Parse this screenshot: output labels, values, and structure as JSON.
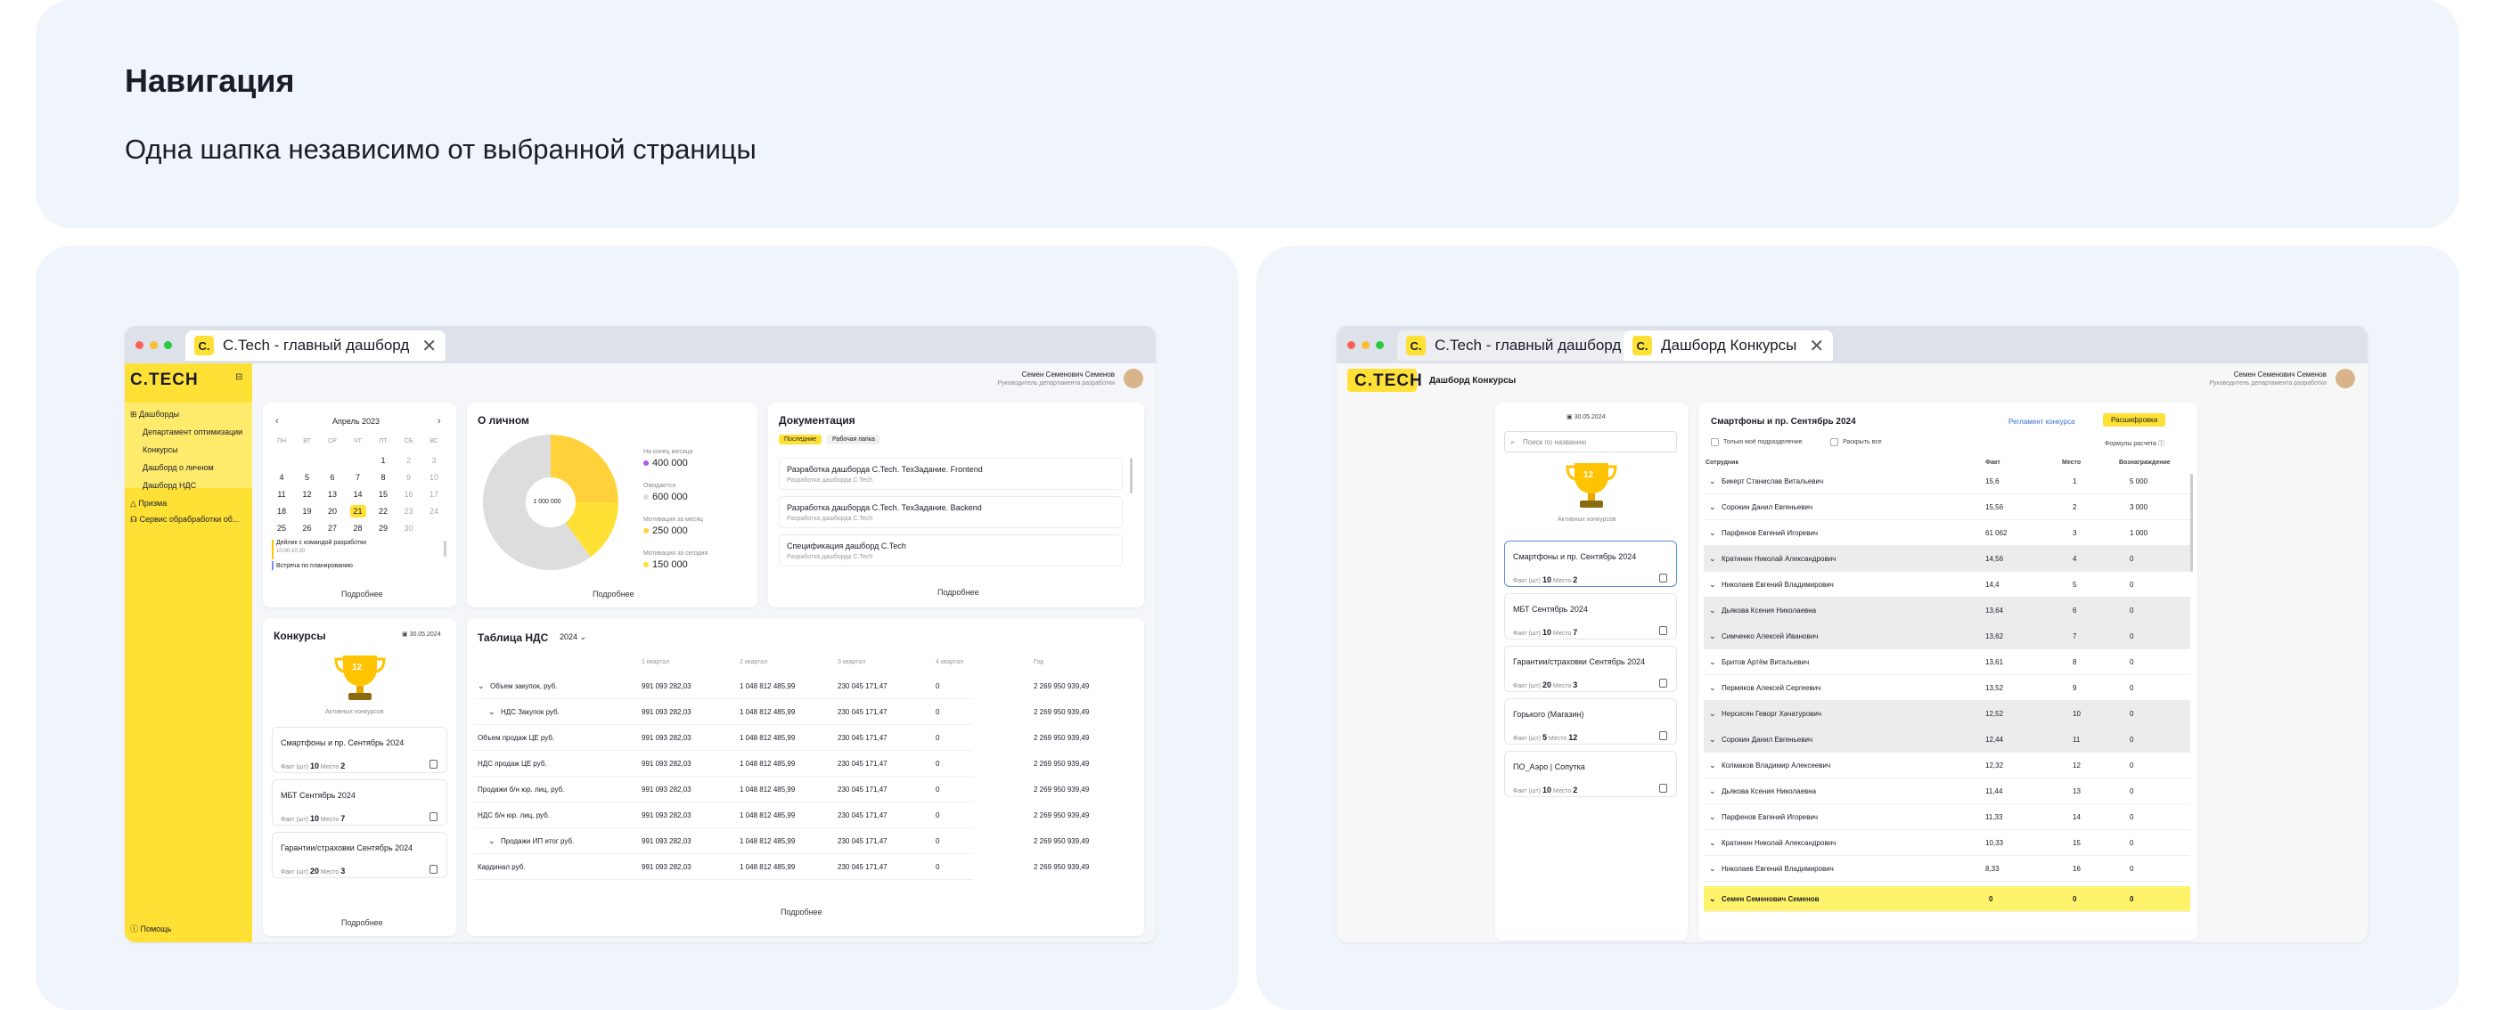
{
  "header": {
    "title": "Навигация",
    "subtitle": "Одна шапка независимо от выбранной страницы"
  },
  "left": {
    "tab": "C.Tech - главный дашборд",
    "logo": "C.TECH",
    "user": {
      "name": "Семен Семенович Семенов",
      "role": "Руководитель департамента разработки"
    },
    "sidebar": {
      "dashboards": "Дашборды",
      "items": [
        "Департамент оптимизации",
        "Конкурсы",
        "Дашборд о личном",
        "Дашборд НДС"
      ],
      "prizma": "Призма",
      "service": "Сервис обрабработки об...",
      "help": "Помощь"
    },
    "calendar": {
      "month": "Апрель 2023",
      "days": [
        "ПН",
        "ВТ",
        "СР",
        "ЧТ",
        "ПТ",
        "СБ",
        "ВС"
      ],
      "weeks": [
        [
          "",
          "",
          "",
          "",
          "1",
          "2",
          "3"
        ],
        [
          "4",
          "5",
          "6",
          "7",
          "8",
          "9",
          "10"
        ],
        [
          "11",
          "12",
          "13",
          "14",
          "15",
          "16",
          "17"
        ],
        [
          "18",
          "19",
          "20",
          "21",
          "22",
          "23",
          "24"
        ],
        [
          "25",
          "26",
          "27",
          "28",
          "29",
          "30",
          ""
        ]
      ],
      "today": "21",
      "events": [
        {
          "title": "Дейлик с командой разработки",
          "time": "10:00-10:30"
        },
        {
          "title": "Встреча по планированию",
          "time": ""
        }
      ],
      "more": "Подробнее"
    },
    "personal": {
      "title": "О личном",
      "center": "1 000 000",
      "stats": [
        {
          "label": "На конец месяца",
          "value": "400 000",
          "color": "#a65cf0"
        },
        {
          "label": "Ожидается",
          "value": "600 000",
          "color": "#dddddd"
        },
        {
          "label": "Мотивация за месяц",
          "value": "250 000",
          "color": "#ffd23c"
        },
        {
          "label": "Мотивация за сегодня",
          "value": "150 000",
          "color": "#ffe135"
        }
      ],
      "more": "Подробнее"
    },
    "docs": {
      "title": "Документация",
      "tabs": [
        "Последние",
        "Рабочая папка"
      ],
      "items": [
        {
          "title": "Разработка дашборда C.Tech. ТехЗадание. Frontend",
          "sub": "Разработка дашборда C.Tech"
        },
        {
          "title": "Разработка дашборда C.Tech. ТехЗадание. Backend",
          "sub": "Разработка дашборда C.Tech"
        },
        {
          "title": "Спецификация дашборд C.Tech",
          "sub": "Разработка дашборда C.Tech"
        }
      ],
      "more": "Подробнее"
    },
    "contests": {
      "title": "Конкурсы",
      "date": "30.05.2024",
      "count": "12",
      "count_label": "Активных конкурсов",
      "fact_label": "Факт (шт)",
      "place_label": "Место",
      "items": [
        {
          "name": "Смартфоны и пр. Сентябрь 2024",
          "fact": "10",
          "place": "2"
        },
        {
          "name": "МБТ Сентябрь 2024",
          "fact": "10",
          "place": "7"
        },
        {
          "name": "Гарантии/страховки Сентябрь 2024",
          "fact": "20",
          "place": "3"
        }
      ],
      "more": "Подробнее"
    },
    "vat": {
      "title": "Таблица НДС",
      "year": "2024",
      "cols": [
        "1 квартал",
        "2 квартал",
        "3 квартал",
        "4 квартал",
        "Год"
      ],
      "rows": [
        {
          "label": "Объем закупок, руб.",
          "chev": true,
          "indent": false,
          "v": [
            "991 093 282,03",
            "1 048 812 485,99",
            "230 045 171,47",
            "0",
            "2 269 950 939,49"
          ]
        },
        {
          "label": "НДС Закупок руб.",
          "chev": true,
          "indent": true,
          "v": [
            "991 093 282,03",
            "1 048 812 485,99",
            "230 045 171,47",
            "0",
            "2 269 950 939,49"
          ]
        },
        {
          "label": "Объем продаж ЦЕ руб.",
          "chev": false,
          "indent": false,
          "v": [
            "991 093 282,03",
            "1 048 812 485,99",
            "230 045 171,47",
            "0",
            "2 269 950 939,49"
          ]
        },
        {
          "label": "НДС продаж ЦЕ руб.",
          "chev": false,
          "indent": false,
          "v": [
            "991 093 282,03",
            "1 048 812 485,99",
            "230 045 171,47",
            "0",
            "2 269 950 939,49"
          ]
        },
        {
          "label": "Продажи б/н юр. лиц, руб.",
          "chev": false,
          "indent": false,
          "v": [
            "991 093 282,03",
            "1 048 812 485,99",
            "230 045 171,47",
            "0",
            "2 269 950 939,49"
          ]
        },
        {
          "label": "НДС б/н юр. лиц, руб.",
          "chev": false,
          "indent": false,
          "v": [
            "991 093 282,03",
            "1 048 812 485,99",
            "230 045 171,47",
            "0",
            "2 269 950 939,49"
          ]
        },
        {
          "label": "Продажи ИП итог руб.",
          "chev": true,
          "indent": true,
          "v": [
            "991 093 282,03",
            "1 048 812 485,99",
            "230 045 171,47",
            "0",
            "2 269 950 939,49"
          ]
        },
        {
          "label": "Кардинал руб.",
          "chev": false,
          "indent": false,
          "v": [
            "991 093 282,03",
            "1 048 812 485,99",
            "230 045 171,47",
            "0",
            "2 269 950 939,49"
          ]
        }
      ],
      "more": "Подробнее"
    }
  },
  "right": {
    "tabs": [
      "C.Tech - главный дашборд",
      "Дашборд Конкурсы"
    ],
    "logo": "C.TECH",
    "page_title": "Дашборд Конкурсы",
    "user": {
      "name": "Семен Семенович Семенов",
      "role": "Руководитель департамента разработки"
    },
    "date": "30.05.2024",
    "search_placeholder": "Поиск по названию",
    "count": "12",
    "count_label": "Активных конкурсов",
    "fact_label": "Факт (шт)",
    "place_label": "Место",
    "list": [
      {
        "name": "Смартфоны и пр. Сентябрь 2024",
        "fact": "10",
        "place": "2"
      },
      {
        "name": "МБТ Сентябрь 2024",
        "fact": "10",
        "place": "7"
      },
      {
        "name": "Гарантии/страховки Сентябрь 2024",
        "fact": "20",
        "place": "3"
      },
      {
        "name": "Горького (Магазин)",
        "fact": "5",
        "place": "12"
      },
      {
        "name": "ПО_Аэро | Сопутка",
        "fact": "10",
        "place": "2"
      }
    ],
    "detail": {
      "title": "Смартфоны и пр. Сентябрь 2024",
      "rules": "Регламент конкурса",
      "breakdown": "Расшифровка",
      "only_mine": "Только моё подразделение",
      "expand_all": "Раскрыть все",
      "formulas": "Формулы расчета",
      "cols": [
        "Сотрудник",
        "Факт",
        "Место",
        "Вознаграждение"
      ],
      "rows": [
        [
          "Бикерт Станислав Витальевич",
          "15,6",
          "1",
          "5 000"
        ],
        [
          "Сорокин Данил Евгеньевич",
          "15,56",
          "2",
          "3 000"
        ],
        [
          "Парфенов Евгений Игоревич",
          "61 062",
          "3",
          "1 000"
        ],
        [
          "Кратинин Николай Александрович",
          "14,56",
          "4",
          "0"
        ],
        [
          "Николаев Евгений Владимирович",
          "14,4",
          "5",
          "0"
        ],
        [
          "Дьякова Ксения Николаевна",
          "13,64",
          "6",
          "0"
        ],
        [
          "Симченко Алексей Иванович",
          "13,62",
          "7",
          "0"
        ],
        [
          "Бритов Артём Витальевич",
          "13,61",
          "8",
          "0"
        ],
        [
          "Пермяков Алексей Сергеевич",
          "13,52",
          "9",
          "0"
        ],
        [
          "Нерсисян Геворг Хачатурович",
          "12,52",
          "10",
          "0"
        ],
        [
          "Сорокин Данил Евгеньевич",
          "12,44",
          "11",
          "0"
        ],
        [
          "Колмаков Владимир Алексеевич",
          "12,32",
          "12",
          "0"
        ],
        [
          "Дьякова Ксения Николаевна",
          "11,44",
          "13",
          "0"
        ],
        [
          "Парфенов Евгений Игоревич",
          "11,33",
          "14",
          "0"
        ],
        [
          "Кратинин Николай Александрович",
          "10,33",
          "15",
          "0"
        ],
        [
          "Николаев Евгений Владимирович",
          "8,33",
          "16",
          "0"
        ]
      ],
      "gray_rows": [
        3,
        5,
        6,
        9,
        10
      ],
      "me": [
        "Семен Семенович Семенов",
        "0",
        "0",
        "0"
      ]
    }
  }
}
